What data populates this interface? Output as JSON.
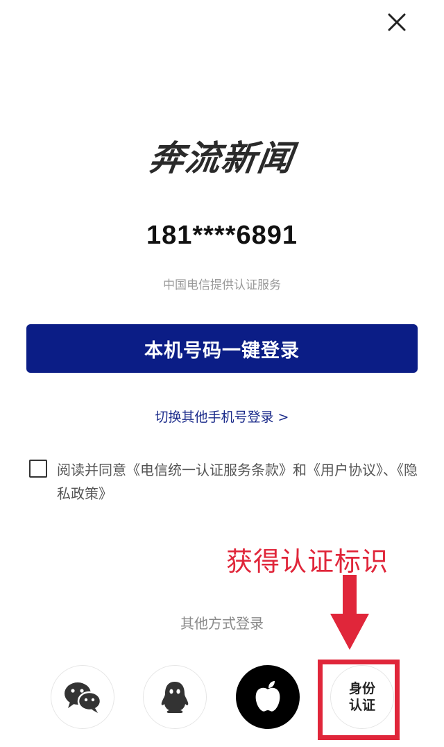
{
  "header": {
    "close_icon": "close-icon"
  },
  "brand": {
    "logo_text": "奔流新闻"
  },
  "login": {
    "masked_phone": "181****6891",
    "provider_note": "中国电信提供认证服务",
    "primary_button": "本机号码一键登录",
    "switch_link": "切换其他手机号登录 >"
  },
  "agreement": {
    "checked": false,
    "text": "阅读并同意《电信统一认证服务条款》和《用户协议》、《隐私政策》"
  },
  "annotation": {
    "label": "获得认证标识",
    "color": "#e0263a"
  },
  "other_login": {
    "title": "其他方式登录",
    "options": [
      {
        "icon": "wechat-icon"
      },
      {
        "icon": "qq-icon"
      },
      {
        "icon": "apple-icon"
      },
      {
        "icon": "id-auth-icon",
        "line1": "身份",
        "line2": "认证"
      }
    ]
  },
  "colors": {
    "primary": "#0b1d86",
    "link": "#1a2a8a"
  }
}
